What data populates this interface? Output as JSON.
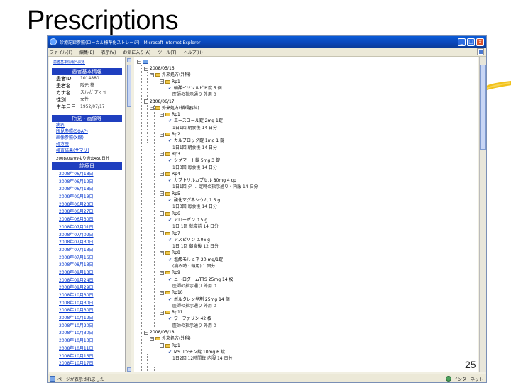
{
  "slide": {
    "title": "Prescriptions",
    "page_number": "25"
  },
  "window": {
    "title": "診療記録参照(ローカル標準化ストレージ) - Microsoft Internet Explorer",
    "menu": [
      "ファイル(F)",
      "編集(E)",
      "表示(V)",
      "お気に入り(A)",
      "ツール(T)",
      "ヘルプ(H)"
    ]
  },
  "left": {
    "home_link": "患者基本情報へ戻る",
    "patient_header": "患者基本情報",
    "patient_rows": [
      {
        "key": "患者ID",
        "value": "1014880"
      },
      {
        "key": "患者名",
        "value": "阪元 葵"
      },
      {
        "key": "カナ名",
        "value": "スルガ アオイ"
      },
      {
        "key": "性別",
        "value": "女性"
      },
      {
        "key": "生年月日",
        "value": "1952/07/17"
      }
    ],
    "findings_header": "所見・画像等",
    "findings_links": [
      "病名",
      "所見参照(SOAP)",
      "画像参照(X線)",
      "処方歴",
      "検査結果(サマリ)"
    ],
    "dates_note": "2008/09/09より過去450日分",
    "dates_header": "診療日",
    "dates": [
      "2008年06月18日",
      "2008年06月12日",
      "2008年06月18日",
      "2008年06月19日",
      "2008年06月23日",
      "2008年06月27日",
      "2008年06月30日",
      "2008年07月01日",
      "2008年07月02日",
      "2008年07月30日",
      "2008年07月13日",
      "2008年07月16日",
      "2008年08月13日",
      "2008年09月13日",
      "2008年09月24日",
      "2008年09月29日",
      "2008年10月30日",
      "2008年10月30日",
      "2008年10月30日",
      "2008年10月12日",
      "2008年10月20日",
      "2008年10月30日",
      "2008年10月13日",
      "2008年10月11日",
      "2008年10月15日",
      "2008年10月17日"
    ]
  },
  "tree": [
    {
      "type": "date",
      "text": "2008/05/16"
    },
    {
      "type": "group",
      "text": "外来処方(外科)"
    },
    {
      "type": "rp",
      "text": "Rp1"
    },
    {
      "type": "drug",
      "text": "硝酸イソソルビド錠 5 個"
    },
    {
      "type": "dose",
      "text": "医師の指示通り 外用 0"
    },
    {
      "type": "date",
      "text": "2008/06/17"
    },
    {
      "type": "group",
      "text": "外来処方(循環器科)"
    },
    {
      "type": "rp",
      "text": "Rp1"
    },
    {
      "type": "drug",
      "text": "エースコール錠 2mg 1錠"
    },
    {
      "type": "dose",
      "text": "1日1回 朝食後 14 日分"
    },
    {
      "type": "rp",
      "text": "Rp2"
    },
    {
      "type": "drug",
      "text": "カルブロック錠 1mg 1 錠"
    },
    {
      "type": "dose",
      "text": "1日1回 朝食後 14 日分"
    },
    {
      "type": "rp",
      "text": "Rp3"
    },
    {
      "type": "drug",
      "text": "シグマート錠 5mg 3 錠"
    },
    {
      "type": "dose",
      "text": "1日3回 毎食後 14 日分"
    },
    {
      "type": "rp",
      "text": "Rp4"
    },
    {
      "type": "drug",
      "text": "カプトリルカプセル 80mg 4 cp"
    },
    {
      "type": "dose",
      "text": "1日1回 夕 ... 定時の指示通り・内服 14 日分"
    },
    {
      "type": "rp",
      "text": "Rp5"
    },
    {
      "type": "drug",
      "text": "酸化マグネシウム 1.5 g"
    },
    {
      "type": "dose",
      "text": "1日3回 毎食後 14 日分"
    },
    {
      "type": "rp",
      "text": "Rp6"
    },
    {
      "type": "drug",
      "text": "アローゼン 0.5 g"
    },
    {
      "type": "dose",
      "text": "1日 1回 就寝前 14 日分"
    },
    {
      "type": "rp",
      "text": "Rp7"
    },
    {
      "type": "drug",
      "text": "アスピリン 0.06 g"
    },
    {
      "type": "dose",
      "text": "1日 1回 朝食後 12 日分"
    },
    {
      "type": "rp",
      "text": "Rp8"
    },
    {
      "type": "drug",
      "text": "塩酸モルヒネ 20 mg/1錠"
    },
    {
      "type": "dose",
      "text": "(痛み時・頓用) 1 回分"
    },
    {
      "type": "rp",
      "text": "Rp9"
    },
    {
      "type": "drug",
      "text": "ニトロダームTTS 25mg 14 枚"
    },
    {
      "type": "dose",
      "text": "医師の指示通り 外用 0"
    },
    {
      "type": "rp",
      "text": "Rp10"
    },
    {
      "type": "drug",
      "text": "ボルタレン坐剤 25mg 14 個"
    },
    {
      "type": "dose",
      "text": "医師の指示通り 外用 0"
    },
    {
      "type": "rp",
      "text": "Rp11"
    },
    {
      "type": "drug",
      "text": "ワーファリン 42 枚"
    },
    {
      "type": "dose",
      "text": "医師の指示通り 外用 0"
    },
    {
      "type": "date",
      "text": "2008/05/18"
    },
    {
      "type": "group",
      "text": "外来処方(外科)"
    },
    {
      "type": "rp",
      "text": "Rp1"
    },
    {
      "type": "drug",
      "text": "MSコンチン錠 10mg 6 錠"
    },
    {
      "type": "dose",
      "text": "1日2回 12時間毎 内服 14 日分"
    }
  ],
  "status": {
    "text": "ページが表示されました",
    "zone": "インターネット"
  },
  "colors": {
    "title_bar": "#0a46b8",
    "section_header": "#1f3fbf",
    "link": "#0033cc"
  }
}
